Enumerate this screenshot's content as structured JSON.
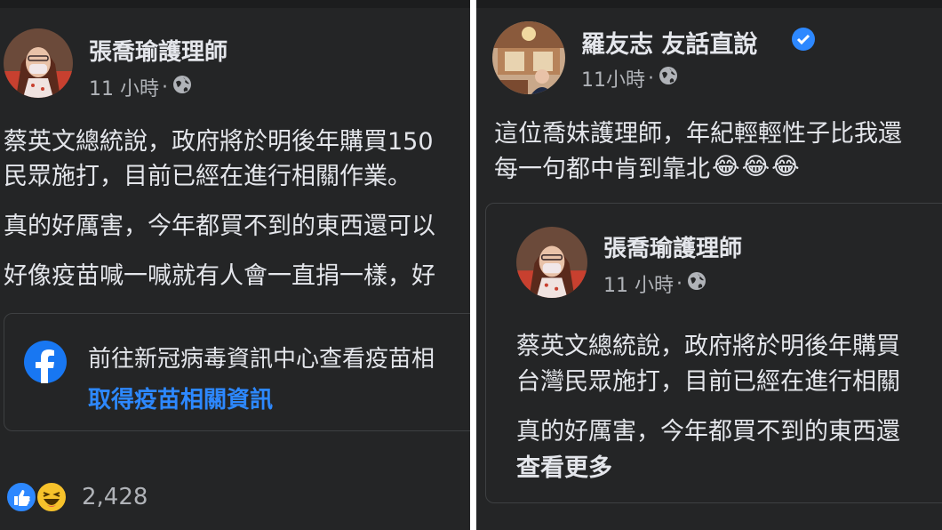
{
  "left_post": {
    "author": "張喬瑜護理師",
    "time": "11 小時",
    "separator": "·",
    "body_lines": [
      "蔡英文總統說，政府將於明後年購買150",
      "民眾施打，目前已經在進行相關作業。",
      "真的好厲害，今年都買不到的東西還可以",
      "好像疫苗喊一喊就有人會一直捐一樣，好"
    ],
    "info_card": {
      "text": "前往新冠病毒資訊中心查看疫苗相",
      "link": "取得疫苗相關資訊"
    },
    "reaction_count": "2,428"
  },
  "right_post": {
    "author": "羅友志 友話直說",
    "time": "11小時",
    "separator": "·",
    "body_lines": [
      "這位喬妹護理師，年紀輕輕性子比我還",
      "每一句都中肯到靠北"
    ],
    "emoji": [
      "😂",
      "😂",
      "😂"
    ],
    "shared": {
      "author": "張喬瑜護理師",
      "time": "11 小時",
      "separator": "·",
      "body_lines": [
        "蔡英文總統說，政府將於明後年購買",
        "台灣民眾施打，目前已經在進行相關",
        "真的好厲害，今年都買不到的東西還"
      ],
      "see_more": "查看更多"
    }
  },
  "colors": {
    "panel_bg": "#242526",
    "text": "#e4e6eb",
    "muted": "#b0b3b8",
    "link": "#2d88ff",
    "facebook": "#1877f2"
  },
  "icons": [
    "globe-icon",
    "facebook-logo-icon",
    "like-reaction-icon",
    "haha-reaction-icon",
    "verified-badge-icon"
  ]
}
